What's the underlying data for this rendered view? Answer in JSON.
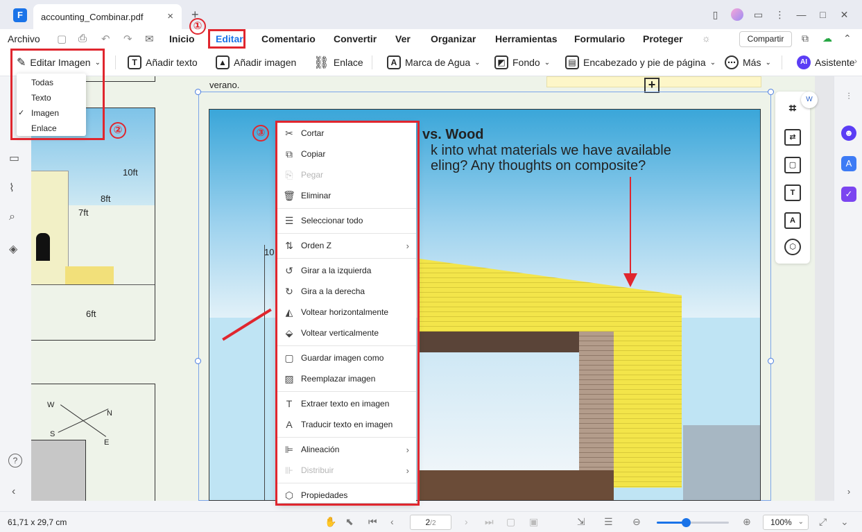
{
  "window": {
    "tab_title": "accounting_Combinar.pdf",
    "tab_close": "×",
    "tab_add": "+",
    "logo": "F"
  },
  "menubar": {
    "archivo": "Archivo",
    "items": [
      "Inicio",
      "Editar",
      "Comentario",
      "Convertir",
      "Ver",
      "Organizar",
      "Herramientas",
      "Formulario",
      "Proteger"
    ],
    "share": "Compartir"
  },
  "toolbar": {
    "edit_image": "Editar Imagen",
    "add_text": "Añadir texto",
    "add_image": "Añadir imagen",
    "link": "Enlace",
    "watermark": "Marca de Agua",
    "background": "Fondo",
    "header_footer": "Encabezado y pie de página",
    "more": "Más",
    "assistant": "Asistente",
    "ai_badge": "AI"
  },
  "edit_image_dropdown": {
    "items": [
      "Todas",
      "Texto",
      "Imagen",
      "Enlace"
    ],
    "selected": "Imagen"
  },
  "annotations": [
    "①",
    "②",
    "③"
  ],
  "document": {
    "page_text_top": "verano.",
    "heading": "vs. Wood",
    "line1": "k into what materials we have available",
    "line2": "eling? Any thoughts on composite?",
    "dim_10ft": "10ft",
    "dim_8ft": "8ft",
    "dim_7ft": "7ft",
    "dim_6ft": "6ft",
    "dim_10": "10",
    "compass_w": "W",
    "compass_n": "N",
    "compass_s": "S",
    "compass_e": "E"
  },
  "context_menu": {
    "items": [
      {
        "label": "Cortar",
        "icon": "scissors-icon",
        "disabled": false
      },
      {
        "label": "Copiar",
        "icon": "copy-icon",
        "disabled": false
      },
      {
        "label": "Pegar",
        "icon": "paste-icon",
        "disabled": true
      },
      {
        "label": "Eliminar",
        "icon": "trash-icon",
        "disabled": false
      },
      {
        "label": "Seleccionar todo",
        "icon": "select-all-icon",
        "disabled": false
      },
      {
        "label": "Orden Z",
        "icon": "z-order-icon",
        "disabled": false,
        "submenu": true
      },
      {
        "label": "Girar a la izquierda",
        "icon": "rotate-left-icon",
        "disabled": false
      },
      {
        "label": "Gira a la derecha",
        "icon": "rotate-right-icon",
        "disabled": false
      },
      {
        "label": "Voltear horizontalmente",
        "icon": "flip-horizontal-icon",
        "disabled": false
      },
      {
        "label": "Voltear verticalmente",
        "icon": "flip-vertical-icon",
        "disabled": false
      },
      {
        "label": "Guardar imagen como",
        "icon": "save-icon",
        "disabled": false
      },
      {
        "label": "Reemplazar imagen",
        "icon": "replace-image-icon",
        "disabled": false
      },
      {
        "label": "Extraer texto en imagen",
        "icon": "extract-text-icon",
        "disabled": false
      },
      {
        "label": "Traducir texto en imagen",
        "icon": "translate-text-icon",
        "disabled": false
      },
      {
        "label": "Alineación",
        "icon": "align-icon",
        "disabled": false,
        "submenu": true
      },
      {
        "label": "Distribuir",
        "icon": "distribute-icon",
        "disabled": true,
        "submenu": true
      },
      {
        "label": "Propiedades",
        "icon": "properties-icon",
        "disabled": false
      }
    ]
  },
  "statusbar": {
    "dimensions": "61,71 x 29,7 cm",
    "page_current": "2",
    "page_total": "/2",
    "zoom": "100%",
    "zoom_level": 0.4
  }
}
